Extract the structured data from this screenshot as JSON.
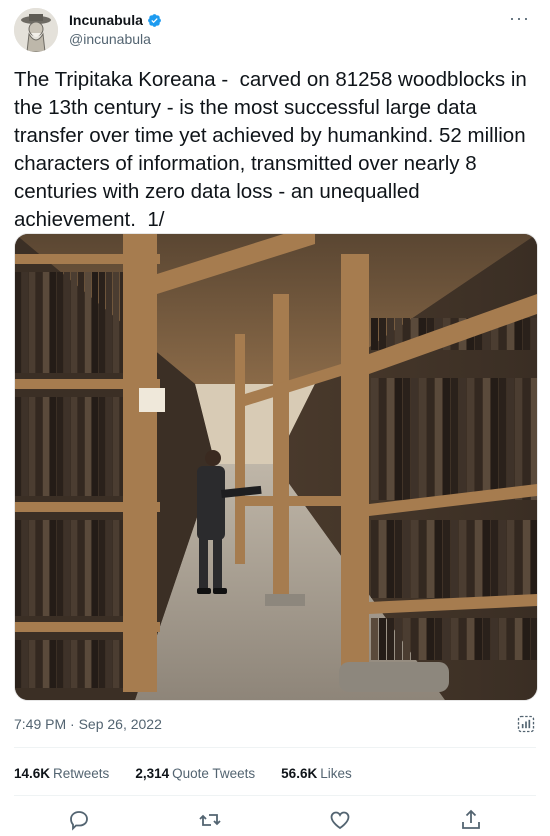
{
  "author": {
    "display_name": "Incunabula",
    "handle": "@incunabula",
    "verified": true
  },
  "menu_icon": "more-horizontal-icon",
  "tweet": {
    "text": "The Tripitaka Koreana -  carved on 81258 woodblocks in the 13th century - is the most successful large data transfer over time yet achieved by humankind. 52 million characters of information, transmitted over nearly 8 centuries with zero data loss - an unequalled achievement.  1/",
    "timestamp": "7:49 PM · Sep 26, 2022"
  },
  "stats": {
    "retweets_count": "14.6K",
    "retweets_label": "Retweets",
    "quotes_count": "2,314",
    "quotes_label": "Quote Tweets",
    "likes_count": "56.6K",
    "likes_label": "Likes"
  },
  "actions": [
    {
      "icon": "reply-icon"
    },
    {
      "icon": "retweet-icon"
    },
    {
      "icon": "like-icon"
    },
    {
      "icon": "share-icon"
    }
  ],
  "colors": {
    "text": "#0f1419",
    "secondary": "#536471",
    "verified": "#1d9bf0",
    "divider": "#eff3f4"
  }
}
